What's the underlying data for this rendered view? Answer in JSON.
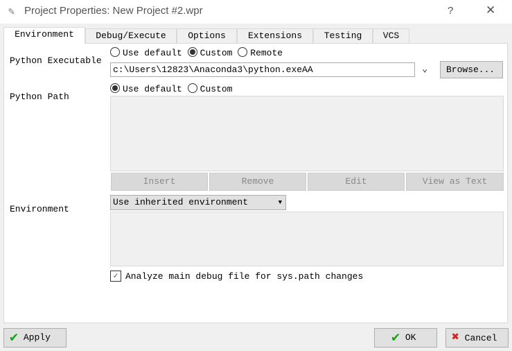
{
  "window": {
    "title": "Project Properties: New Project #2.wpr",
    "help": "?",
    "close": "✕"
  },
  "tabs": [
    {
      "label": "Environment",
      "active": true
    },
    {
      "label": "Debug/Execute"
    },
    {
      "label": "Options"
    },
    {
      "label": "Extensions"
    },
    {
      "label": "Testing"
    },
    {
      "label": "VCS"
    }
  ],
  "python_executable": {
    "label": "Python Executable",
    "options": [
      "Use default",
      "Custom",
      "Remote"
    ],
    "selected": "Custom",
    "value": "c:\\Users\\12823\\Anaconda3\\python.exeAA",
    "browse": "Browse..."
  },
  "python_path": {
    "label": "Python Path",
    "options": [
      "Use default",
      "Custom"
    ],
    "selected": "Use default",
    "buttons": [
      "Insert",
      "Remove",
      "Edit",
      "View as Text"
    ]
  },
  "environment": {
    "label": "Environment",
    "dropdown": "Use inherited environment"
  },
  "analyze": {
    "label": "Analyze main debug file for sys.path changes",
    "checked": true
  },
  "footer": {
    "apply": "Apply",
    "ok": "OK",
    "cancel": "Cancel"
  },
  "colors": {
    "check_green": "#1aa31a",
    "cancel_red": "#d42020"
  }
}
